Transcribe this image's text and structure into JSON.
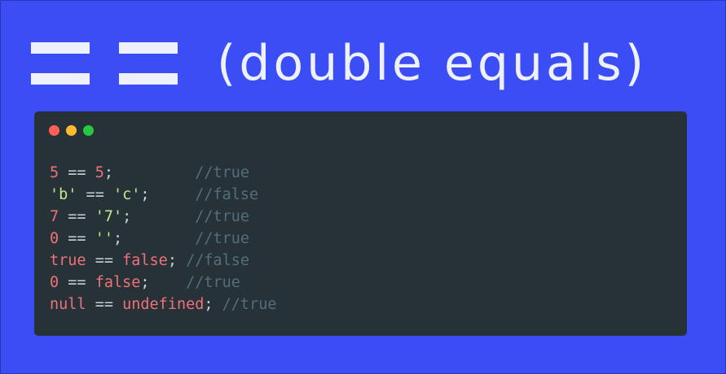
{
  "title": {
    "text": "(double equals)"
  },
  "window": {
    "dots": [
      {
        "name": "close",
        "color": "#ff5f56"
      },
      {
        "name": "minimize",
        "color": "#ffbd2e"
      },
      {
        "name": "maximize",
        "color": "#27c93f"
      }
    ]
  },
  "colors": {
    "background": "#3b4ef5",
    "editor": "#263238",
    "number": "#f07178",
    "string": "#c3e88d",
    "keyword": "#f07178",
    "operator": "#c8d0d6",
    "comment": "#546e7a"
  },
  "code_lines": [
    [
      {
        "t": "5",
        "k": "number"
      },
      {
        "t": " == ",
        "k": "operator"
      },
      {
        "t": "5",
        "k": "number"
      },
      {
        "t": ";         ",
        "k": "operator"
      },
      {
        "t": "//true",
        "k": "comment"
      }
    ],
    [
      {
        "t": "'b'",
        "k": "string"
      },
      {
        "t": " == ",
        "k": "operator"
      },
      {
        "t": "'c'",
        "k": "string"
      },
      {
        "t": ";     ",
        "k": "operator"
      },
      {
        "t": "//false",
        "k": "comment"
      }
    ],
    [
      {
        "t": "7",
        "k": "number"
      },
      {
        "t": " == ",
        "k": "operator"
      },
      {
        "t": "'7'",
        "k": "string"
      },
      {
        "t": ";       ",
        "k": "operator"
      },
      {
        "t": "//true",
        "k": "comment"
      }
    ],
    [
      {
        "t": "0",
        "k": "number"
      },
      {
        "t": " == ",
        "k": "operator"
      },
      {
        "t": "''",
        "k": "string"
      },
      {
        "t": ";        ",
        "k": "operator"
      },
      {
        "t": "//true",
        "k": "comment"
      }
    ],
    [
      {
        "t": "true",
        "k": "keyword"
      },
      {
        "t": " == ",
        "k": "operator"
      },
      {
        "t": "false",
        "k": "keyword"
      },
      {
        "t": "; ",
        "k": "operator"
      },
      {
        "t": "//false",
        "k": "comment"
      }
    ],
    [
      {
        "t": "0",
        "k": "number"
      },
      {
        "t": " == ",
        "k": "operator"
      },
      {
        "t": "false",
        "k": "keyword"
      },
      {
        "t": ";    ",
        "k": "operator"
      },
      {
        "t": "//true",
        "k": "comment"
      }
    ],
    [
      {
        "t": "null",
        "k": "keyword"
      },
      {
        "t": " == ",
        "k": "operator"
      },
      {
        "t": "undefined",
        "k": "keyword"
      },
      {
        "t": "; ",
        "k": "operator"
      },
      {
        "t": "//true",
        "k": "comment"
      }
    ]
  ]
}
